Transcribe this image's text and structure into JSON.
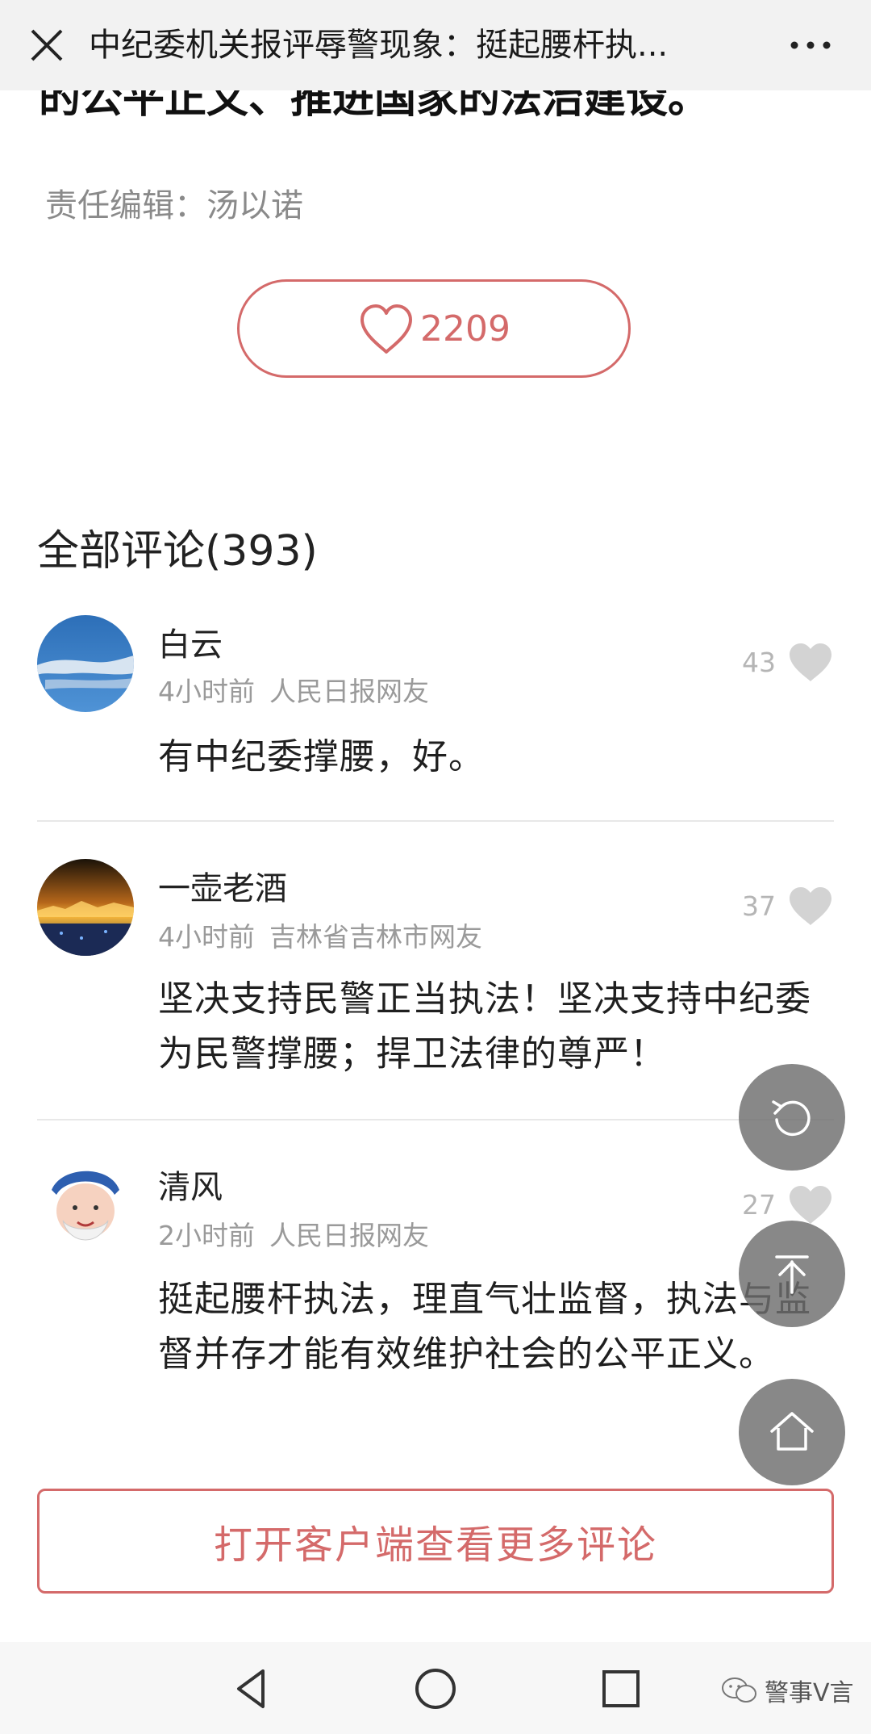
{
  "topbar": {
    "title": "中纪委机关报评辱警现象：挺起腰杆执..."
  },
  "article": {
    "tail_text": "的公平正义、推进国家的法治建设。",
    "editor": "责任编辑：汤以诺"
  },
  "like": {
    "count": "2209"
  },
  "comments_section": {
    "title": "全部评论(393)"
  },
  "comments": [
    {
      "name": "白云",
      "time": "4小时前",
      "location": "人民日报网友",
      "likes": "43",
      "text": "有中纪委撑腰，好。"
    },
    {
      "name": "一壶老酒",
      "time": "4小时前",
      "location": "吉林省吉林市网友",
      "likes": "37",
      "text": "坚决支持民警正当执法！坚决支持中纪委为民警撑腰；捍卫法律的尊严！"
    },
    {
      "name": "清风",
      "time": "2小时前",
      "location": "人民日报网友",
      "likes": "27",
      "text": "挺起腰杆执法，理直气壮监督，执法与监督并存才能有效维护社会的公平正义。"
    }
  ],
  "open_client": {
    "label": "打开客户端查看更多评论"
  },
  "watermark": {
    "text": "警事V言"
  },
  "colors": {
    "accent": "#d46a6a",
    "fab": "#6e6e6e"
  }
}
